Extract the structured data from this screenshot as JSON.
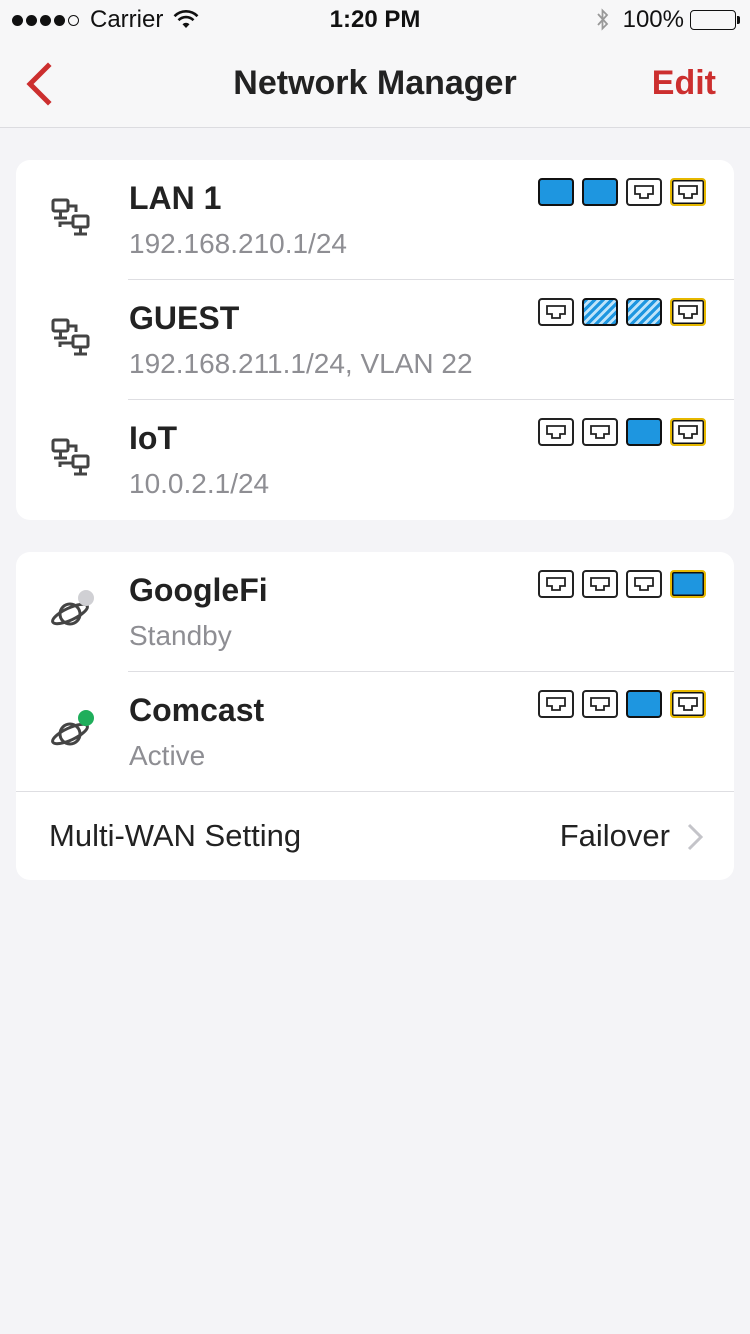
{
  "status_bar": {
    "carrier": "Carrier",
    "time": "1:20 PM",
    "battery": "100%"
  },
  "nav": {
    "title": "Network Manager",
    "edit_label": "Edit"
  },
  "lan_networks": [
    {
      "name": "LAN 1",
      "subtitle": "192.168.210.1/24",
      "ports": [
        "active",
        "active",
        "empty",
        "wan"
      ]
    },
    {
      "name": "GUEST",
      "subtitle": "192.168.211.1/24, VLAN 22",
      "ports": [
        "empty",
        "hatched",
        "hatched",
        "wan"
      ]
    },
    {
      "name": "IoT",
      "subtitle": "10.0.2.1/24",
      "ports": [
        "empty",
        "empty",
        "active",
        "wan"
      ]
    }
  ],
  "wan_networks": [
    {
      "name": "GoogleFi",
      "status": "Standby",
      "status_color": "#d0d0d4",
      "ports": [
        "empty",
        "empty",
        "empty",
        "wan-active"
      ]
    },
    {
      "name": "Comcast",
      "status": "Active",
      "status_color": "#1fae5b",
      "ports": [
        "empty",
        "empty",
        "active",
        "wan"
      ]
    }
  ],
  "multi_wan": {
    "label": "Multi-WAN Setting",
    "value": "Failover"
  },
  "colors": {
    "accent": "#cc2f2f",
    "port_active": "#1e96e0",
    "wan_port_border": "#e6b800"
  }
}
